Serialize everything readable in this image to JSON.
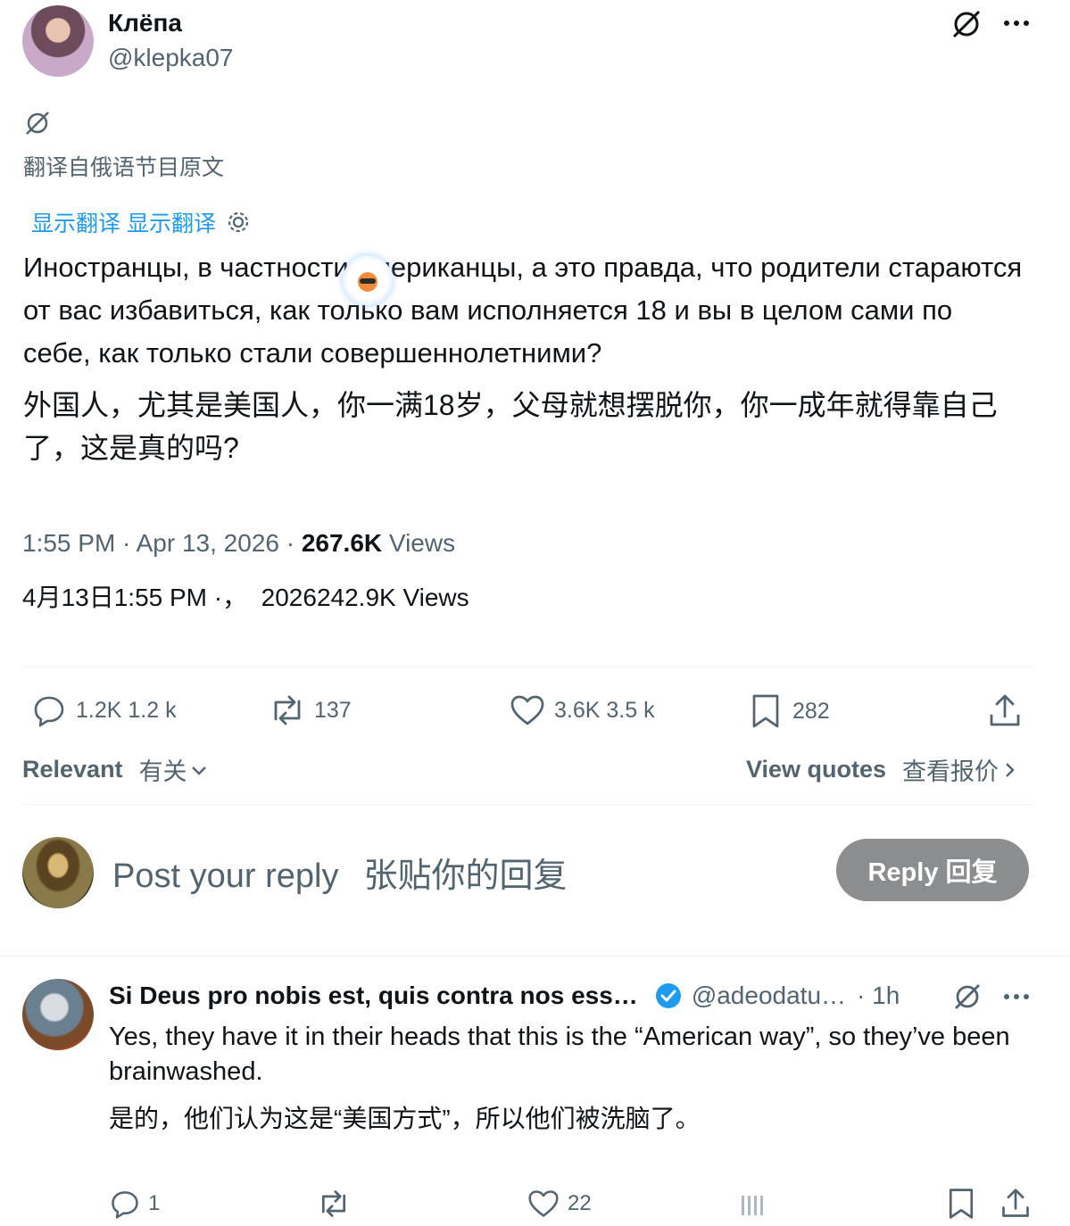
{
  "post": {
    "display_name": "Клёпа",
    "handle": "@klepka07",
    "translated_from": "翻译自俄语节目原文",
    "show_translation": "显示翻译 显示翻译",
    "text_ru": "Иностранцы, в частности американцы, а это правда, что родители стараются от вас избавиться, как только вам исполняется 18 и вы в целом сами по себе, как только стали совершеннолетними?",
    "text_zh": "外国人，尤其是美国人，你一满18岁，父母就想摆脱你，你一成年就得靠自己了，这是真的吗?",
    "time": "1:55 PM · Apr 13, 2026 · ",
    "views_count": "267.6K",
    "views_label": " Views",
    "time_zh": "4月13日1:55 PM ·，  2026242.9K Views"
  },
  "actions": {
    "replies": "1.2K 1.2 k",
    "reposts": "137",
    "likes": "3.6K 3.5 k",
    "bookmarks": "282"
  },
  "sort": {
    "relevant": "Relevant",
    "relevant_zh": "有关",
    "view_quotes": "View quotes",
    "view_quotes_zh": "查看报价"
  },
  "composer": {
    "placeholder": "Post your reply",
    "placeholder_zh": "张贴你的回复",
    "reply_button": "Reply 回复"
  },
  "reply": {
    "display_name": "Si Deus pro nobis est, quis contra nos ess…",
    "handle": "@adeodatu…",
    "time": "· 1h",
    "text_en": "Yes, they have it in their heads that this is the “American way”, so they’ve been brainwashed.",
    "text_zh": "是的，他们认为这是“美国方式”，所以他们被洗脑了。",
    "replies": "1",
    "likes": "22"
  },
  "colors": {
    "accent": "#1d9bf0",
    "muted": "#536471",
    "reply_button_bg": "#8b8d8f"
  }
}
